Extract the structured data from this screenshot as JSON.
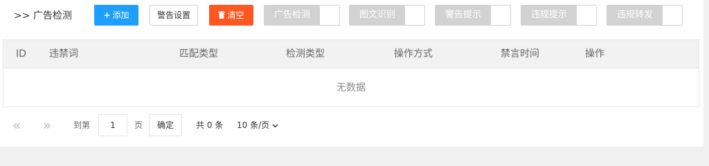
{
  "toolbar": {
    "title": ">> 广告检测",
    "add_label": "添加",
    "warn_settings_label": "警告设置",
    "clear_label": "清空",
    "toggles": [
      {
        "label": "广告检测",
        "enabled": false
      },
      {
        "label": "图文识别",
        "enabled": false
      },
      {
        "label": "警告提示",
        "enabled": false
      },
      {
        "label": "违规提示",
        "enabled": false
      },
      {
        "label": "违规转发",
        "enabled": false
      }
    ]
  },
  "table": {
    "columns": [
      "ID",
      "违禁词",
      "匹配类型",
      "检测类型",
      "操作方式",
      "禁言时间",
      "操作"
    ],
    "rows": [],
    "empty_text": "无数据"
  },
  "pagination": {
    "first_icon": "«",
    "prev_icon": "»",
    "goto_label": "到第",
    "current_page": "1",
    "page_unit": "页",
    "confirm_label": "确定",
    "total_text": "共 0 条",
    "page_size": "10 条/页"
  },
  "colors": {
    "primary": "#1e9fff",
    "danger": "#ff5722",
    "toggle_off": "#d2d2d2"
  }
}
